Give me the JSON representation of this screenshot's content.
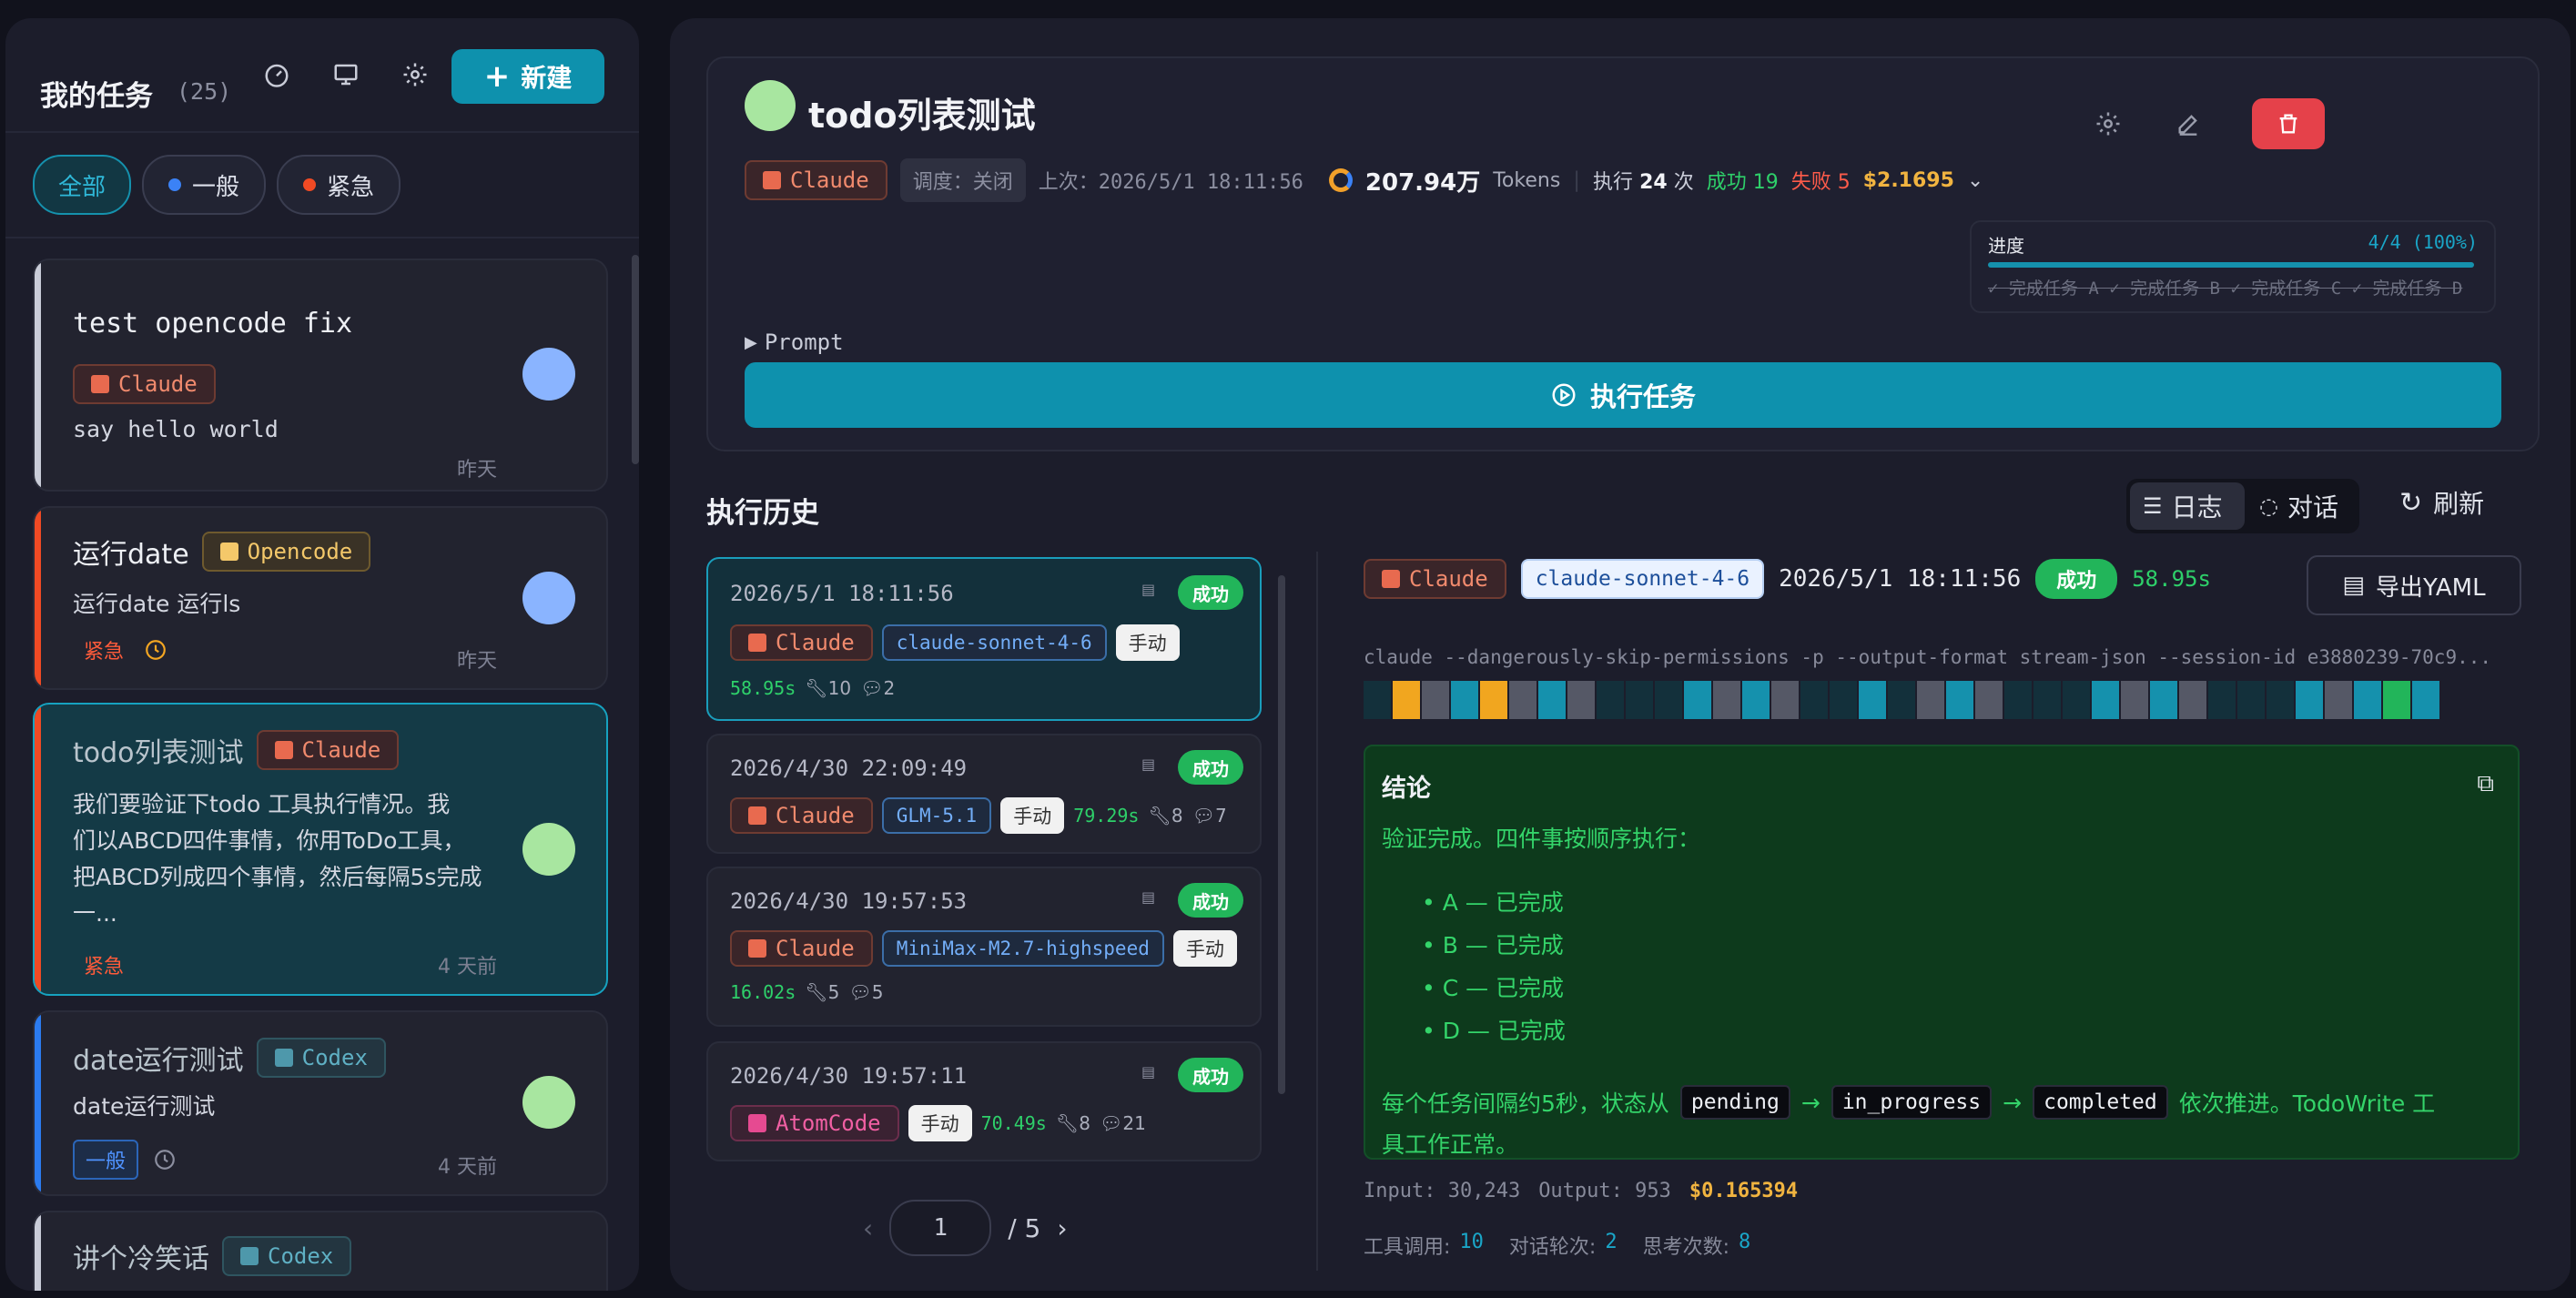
{
  "sidebar": {
    "title": "我的任务",
    "count": "(25)",
    "new_button": "新建",
    "filters": [
      {
        "label": "全部"
      },
      {
        "label": "一般",
        "color": "#3b82f6"
      },
      {
        "label": "紧急",
        "color": "#f04a24"
      }
    ],
    "tasks": [
      {
        "title": "test opencode fix",
        "agent": "Claude",
        "desc": "say hello world",
        "time": "昨天",
        "avatar": "#8ab4ff"
      },
      {
        "title": "运行date",
        "agent": "Opencode",
        "desc": "运行date 运行ls",
        "priority": "紧急",
        "time": "昨天",
        "avatar": "#8ab4ff"
      },
      {
        "title": "todo列表测试",
        "agent": "Claude",
        "desc_lines": [
          "我们要验证下todo 工具执行情况。我",
          "们以ABCD四件事情，你用ToDo工具，",
          "把ABCD列成四个事情，然后每隔5s完成",
          "一..."
        ],
        "priority": "紧急",
        "time": "4 天前",
        "avatar": "#a8e6a0"
      },
      {
        "title": "date运行测试",
        "agent": "Codex",
        "desc": "date运行测试",
        "priority": "一般",
        "time": "4 天前",
        "avatar": "#a8e6a0"
      },
      {
        "title": "讲个冷笑话",
        "agent": "Codex"
      }
    ]
  },
  "task": {
    "title": "todo列表测试",
    "agent": "Claude",
    "schedule": "调度：关闭",
    "last_run": "上次：2026/5/1 18:11:56",
    "tokens_value": "207.94万",
    "tokens_label": "Tokens",
    "exec_prefix": "执行",
    "exec_count": "24",
    "exec_suffix": "次",
    "success": "成功 19",
    "fail": "失败 5",
    "cost": "$2.1695",
    "progress_label": "进度",
    "progress_value": "4/4 (100%)",
    "progress_fraction": 1.0,
    "progress_items": "✓ 完成任务 A ✓ 完成任务 B ✓ 完成任务 C ✓ 完成任务 D",
    "prompt_label": "Prompt",
    "run_button": "执行任务"
  },
  "history": {
    "title": "执行历史",
    "tabs": {
      "log": "日志",
      "chat": "对话"
    },
    "refresh": "刷新",
    "items": [
      {
        "date": "2026/5/1 18:11:56",
        "status": "成功",
        "agent": "Claude",
        "model": "claude-sonnet-4-6",
        "mode": "手动",
        "duration": "58.95s",
        "tools": "10",
        "turns": "2"
      },
      {
        "date": "2026/4/30 22:09:49",
        "status": "成功",
        "agent": "Claude",
        "model": "GLM-5.1",
        "mode": "手动",
        "duration": "79.29s",
        "tools": "8",
        "turns": "7"
      },
      {
        "date": "2026/4/30 19:57:53",
        "status": "成功",
        "agent": "Claude",
        "model": "MiniMax-M2.7-highspeed",
        "mode": "手动",
        "duration": "16.02s",
        "tools": "5",
        "turns": "5"
      },
      {
        "date": "2026/4/30 19:57:11",
        "status": "成功",
        "agent": "AtomCode",
        "mode": "手动",
        "duration": "70.49s",
        "tools": "8",
        "turns": "21"
      }
    ],
    "page_current": "1",
    "page_total": "/ 5"
  },
  "detail": {
    "agent": "Claude",
    "model": "claude-sonnet-4-6",
    "date": "2026/5/1 18:11:56",
    "status": "成功",
    "duration": "58.95s",
    "export": "导出YAML",
    "command": "claude --dangerously-skip-permissions -p --output-format stream-json --session-id e3880239-70c9...",
    "result_title": "结论",
    "result_intro": "验证完成。四件事按顺序执行：",
    "result_items": [
      "A — 已完成",
      "B — 已完成",
      "C — 已完成",
      "D — 已完成"
    ],
    "result_p1": "每个任务间隔约5秒，状态从",
    "code1": "pending",
    "arrow": "→",
    "code2": "in_progress",
    "code3": "completed",
    "result_p2": "依次推进。TodoWrite 工",
    "result_p3": "具工作正常。",
    "input_label": "Input: 30,243",
    "output_label": "Output: 953",
    "cost": "$0.165394",
    "tool_calls_label": "工具调用:",
    "tool_calls": "10",
    "turns_label": "对话轮次:",
    "turns": "2",
    "think_label": "思考次数:",
    "think": "8"
  },
  "colors": {
    "accent": "#0e91ad",
    "success": "#22b55a",
    "danger": "#e5414a"
  }
}
